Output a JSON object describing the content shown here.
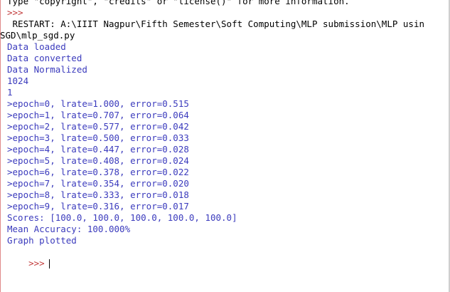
{
  "console": {
    "banner": "Type \"copyright\", \"credits\" or \"license()\" for more information.",
    "prompt_prev": ">>>",
    "restart_line": " RESTART: A:\\IIIT Nagpur\\Fifth Semester\\Soft Computing\\MLP submission\\MLP usin",
    "restart_line_cont": "SGD\\mlp_sgd.py",
    "outputs": [
      "Data loaded",
      "Data converted",
      "Data Normalized",
      "1024",
      "1"
    ],
    "epochs": [
      ">epoch=0, lrate=1.000, error=0.515",
      ">epoch=1, lrate=0.707, error=0.064",
      ">epoch=2, lrate=0.577, error=0.042",
      ">epoch=3, lrate=0.500, error=0.033",
      ">epoch=4, lrate=0.447, error=0.028",
      ">epoch=5, lrate=0.408, error=0.024",
      ">epoch=6, lrate=0.378, error=0.022",
      ">epoch=7, lrate=0.354, error=0.020",
      ">epoch=8, lrate=0.333, error=0.018",
      ">epoch=9, lrate=0.316, error=0.017"
    ],
    "scores": "Scores: [100.0, 100.0, 100.0, 100.0, 100.0]",
    "mean_accuracy": "Mean Accuracy: 100.000%",
    "graph_plotted": "Graph plotted",
    "prompt_current": ">>>"
  },
  "colors": {
    "output": "#3b3bbd",
    "prompt": "#c23b3b",
    "text": "#000000"
  }
}
